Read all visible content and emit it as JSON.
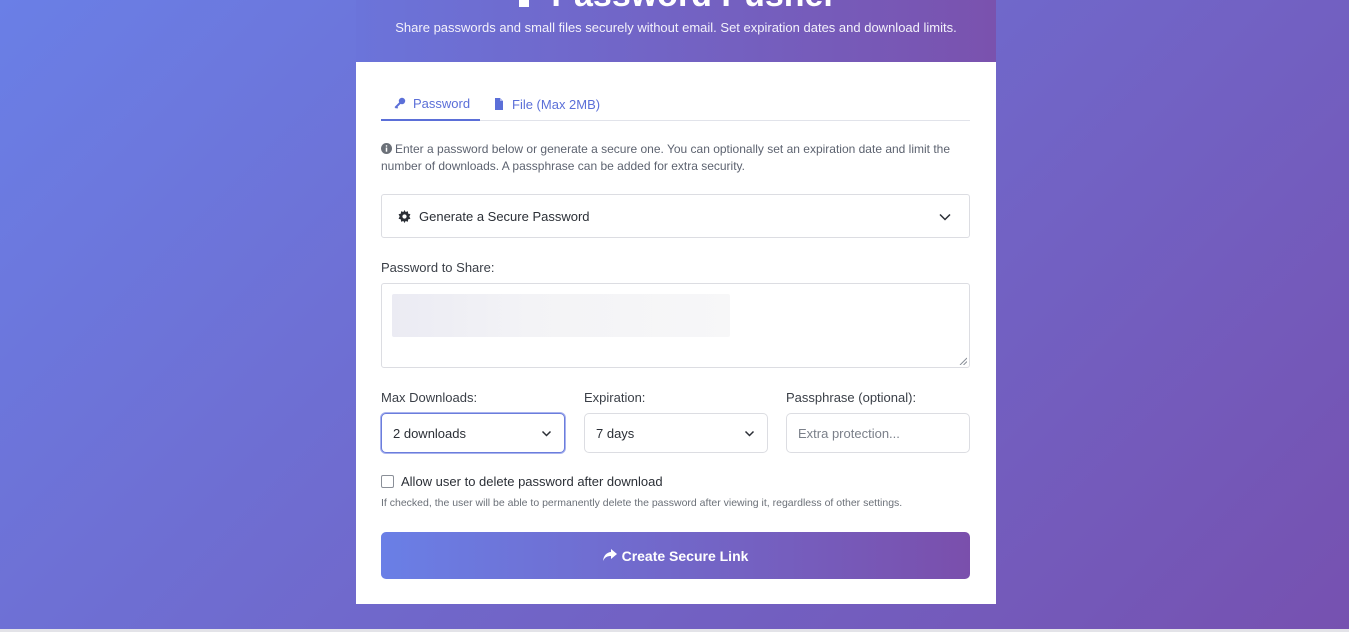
{
  "header": {
    "title": "Password Pusher",
    "subtitle": "Share passwords and small files securely without email. Set expiration dates and download limits."
  },
  "tabs": [
    {
      "label": "Password",
      "icon": "key-icon",
      "active": true
    },
    {
      "label": "File (Max 2MB)",
      "icon": "file-icon",
      "active": false
    }
  ],
  "info_text": "Enter a password below or generate a secure one. You can optionally set an expiration date and limit the number of downloads. A passphrase can be added for extra security.",
  "generator": {
    "label": "Generate a Secure Password",
    "icon": "gear-icon"
  },
  "password_field": {
    "label": "Password to Share:"
  },
  "max_downloads": {
    "label": "Max Downloads:",
    "value": "2 downloads"
  },
  "expiration": {
    "label": "Expiration:",
    "value": "7 days"
  },
  "passphrase": {
    "label": "Passphrase (optional):",
    "placeholder": "Extra protection..."
  },
  "allow_delete": {
    "label": "Allow user to delete password after download",
    "checked": false
  },
  "help_text": "If checked, the user will be able to permanently delete the password after viewing it, regardless of other settings.",
  "submit": {
    "label": "Create Secure Link",
    "icon": "share-icon"
  },
  "colors": {
    "accent": "#5b6fd8",
    "gradient_start": "#6a7fe6",
    "gradient_end": "#7a4fac"
  }
}
